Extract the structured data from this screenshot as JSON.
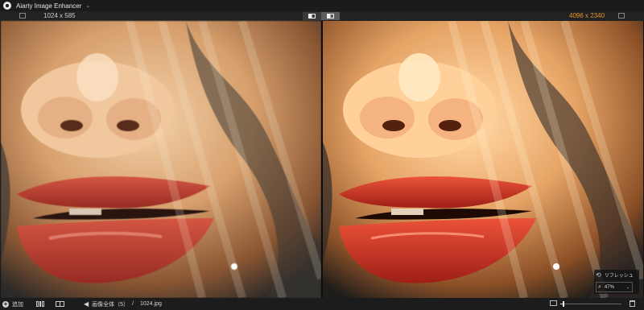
{
  "app": {
    "title": "Aiarty Image Enhancer",
    "title_caret": "⌄"
  },
  "toolbar": {
    "left_size": "1024 x 585",
    "right_size": "4096 x 2340"
  },
  "bottombar": {
    "add_label": "追加",
    "back_glyph": "◀",
    "crumb_all": "画像全体（5）",
    "crumb_sep": "/",
    "crumb_file": "1024.jpg"
  },
  "zoom": {
    "refresh_label": "リフレッシュ",
    "refresh_glyph": "⟲",
    "glass_glyph": "⌕",
    "value": "47%",
    "caret": "⌄",
    "slider_fraction": 0.04
  },
  "colors": {
    "accent": "#e8952a",
    "bg": "#141414"
  },
  "icons": [
    "app-logo-icon",
    "settings-icon",
    "split-view-icon",
    "side-by-side-icon",
    "add-icon",
    "grid-view-icon",
    "compare-view-icon",
    "image-icon",
    "trash-icon",
    "refresh-icon",
    "zoom-icon"
  ]
}
